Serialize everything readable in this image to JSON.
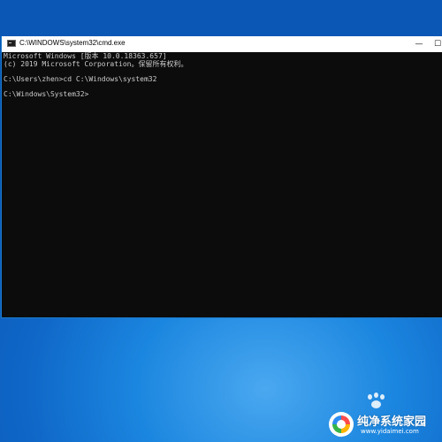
{
  "window": {
    "title": "C:\\WINDOWS\\system32\\cmd.exe",
    "app_icon": "cmd-icon",
    "controls": {
      "minimize": "—",
      "maximize": "☐",
      "close": "×"
    }
  },
  "console": {
    "lines": [
      "Microsoft Windows [版本 10.0.18363.657]",
      "(c) 2019 Microsoft Corporation。保留所有权利。",
      "",
      "C:\\Users\\zhen>cd C:\\Windows\\system32",
      "",
      "C:\\Windows\\System32>"
    ],
    "text_color": "#cccccc",
    "background": "#0c0c0c"
  },
  "desktop": {
    "background": "#1b86df"
  },
  "watermark": {
    "title": "纯净系统家园",
    "url": "www.yidaimei.com"
  }
}
